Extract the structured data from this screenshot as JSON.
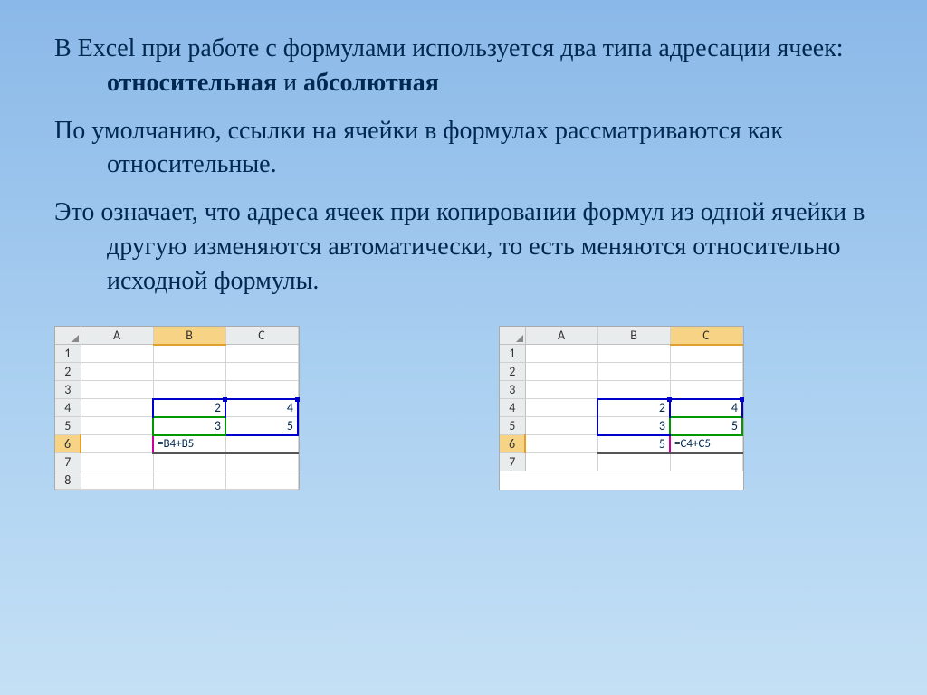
{
  "paragraphs": {
    "p1_a": "В Excel при работе с формулами используется два типа адресации ячеек: ",
    "p1_bold1": "относительная",
    "p1_mid": " и ",
    "p1_bold2": "абсолютная",
    "p2": "По умолчанию, ссылки на ячейки в формулах рассматриваются как относительные.",
    "p3": "Это означает, что адреса ячеек при копировании формул из одной ячейки в другую изменяются автоматически, то есть меняются относительно исходной формулы."
  },
  "sheet1": {
    "cols": [
      "A",
      "B",
      "C"
    ],
    "rows": [
      "1",
      "2",
      "3",
      "4",
      "5",
      "6",
      "7",
      "8"
    ],
    "active_col": "B",
    "active_row": "6",
    "cells": {
      "B4": "2",
      "C4": "4",
      "B5": "3",
      "C5": "5",
      "B6": "=B4+B5"
    }
  },
  "sheet2": {
    "cols": [
      "A",
      "B",
      "C"
    ],
    "rows": [
      "1",
      "2",
      "3",
      "4",
      "5",
      "6",
      "7"
    ],
    "active_col": "C",
    "active_row": "6",
    "cells": {
      "B4": "2",
      "C4": "4",
      "B5": "3",
      "C5": "5",
      "B6": "5",
      "C6": "=C4+C5"
    }
  }
}
